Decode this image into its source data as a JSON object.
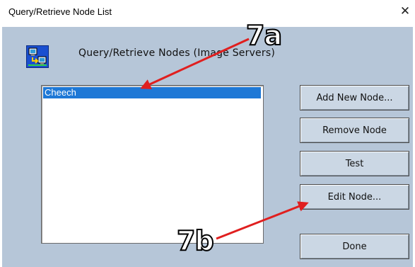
{
  "window": {
    "title": "Query/Retrieve Node List",
    "close_glyph": "✕"
  },
  "header": {
    "icon": "network-computers-icon",
    "label": "Query/Retrieve Nodes (Image Servers)"
  },
  "node_list": {
    "items": [
      {
        "label": "Cheech",
        "selected": true
      }
    ]
  },
  "buttons": {
    "add_new_node": "Add New Node...",
    "remove_node": "Remove Node",
    "test": "Test",
    "edit_node": "Edit Node...",
    "done": "Done"
  },
  "annotations": {
    "callout_a": "7a",
    "callout_b": "7b",
    "arrow_color": "#e01f1f"
  },
  "colors": {
    "dialog_bg": "#b6c6d8",
    "selection": "#1e78d6",
    "button_bg": "#cbd7e4"
  }
}
